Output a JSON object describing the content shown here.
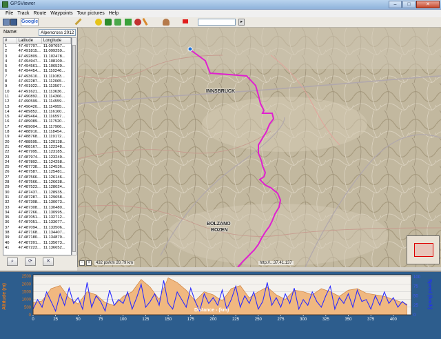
{
  "window": {
    "title": "GPSViewer",
    "minimize": "–",
    "maximize": "□",
    "close": "✕"
  },
  "menu": [
    "File",
    "Track",
    "Route",
    "Waypoints",
    "Tour pictures",
    "Help"
  ],
  "toolbar": {
    "google_label": "Google",
    "search_value": "",
    "search_go": "▸"
  },
  "panel": {
    "name_label": "Name:",
    "name_value": "Alpencross 2012",
    "columns": [
      "#",
      "Latitude",
      "Longitude"
    ],
    "rows": [
      [
        "1",
        "47.497707...",
        "11.097657..."
      ],
      [
        "2",
        "47.491815...",
        "11.099259..."
      ],
      [
        "3",
        "47.492809...",
        "11.102478..."
      ],
      [
        "4",
        "47.494947...",
        "11.108109..."
      ],
      [
        "5",
        "47.494561...",
        "11.106529..."
      ],
      [
        "6",
        "47.494454...",
        "11.110246..."
      ],
      [
        "7",
        "47.493610...",
        "11.111083..."
      ],
      [
        "8",
        "47.492287...",
        "11.112065..."
      ],
      [
        "9",
        "47.491922...",
        "11.113507..."
      ],
      [
        "10",
        "47.491621...",
        "11.113636..."
      ],
      [
        "11",
        "47.490892...",
        "11.114366..."
      ],
      [
        "12",
        "47.490599...",
        "11.114559..."
      ],
      [
        "13",
        "47.490420...",
        "11.114955..."
      ],
      [
        "14",
        "47.489852...",
        "11.116160..."
      ],
      [
        "15",
        "47.489464...",
        "11.116597..."
      ],
      [
        "16",
        "47.489089...",
        "11.117520..."
      ],
      [
        "17",
        "47.489004...",
        "11.117906..."
      ],
      [
        "18",
        "47.488910...",
        "11.118454..."
      ],
      [
        "19",
        "47.488768...",
        "11.119172..."
      ],
      [
        "20",
        "47.488595...",
        "11.120138..."
      ],
      [
        "21",
        "47.488167...",
        "11.122348..."
      ],
      [
        "22",
        "47.487995...",
        "11.123185..."
      ],
      [
        "23",
        "47.487974...",
        "11.123249..."
      ],
      [
        "24",
        "47.487802...",
        "11.124258..."
      ],
      [
        "25",
        "47.487738...",
        "11.124536..."
      ],
      [
        "26",
        "47.487587...",
        "11.125481..."
      ],
      [
        "27",
        "47.487566...",
        "11.126146..."
      ],
      [
        "28",
        "47.487566...",
        "11.126638..."
      ],
      [
        "29",
        "47.487523...",
        "11.128024..."
      ],
      [
        "30",
        "47.487437...",
        "11.128935..."
      ],
      [
        "31",
        "47.487287...",
        "11.129658..."
      ],
      [
        "32",
        "47.487308...",
        "11.130073..."
      ],
      [
        "33",
        "47.487308...",
        "11.130480..."
      ],
      [
        "34",
        "47.487266...",
        "11.130995..."
      ],
      [
        "35",
        "47.487051...",
        "11.132712..."
      ],
      [
        "36",
        "47.487051...",
        "11.133077..."
      ],
      [
        "37",
        "47.487094...",
        "11.133506..."
      ],
      [
        "38",
        "47.487168...",
        "11.134407..."
      ],
      [
        "39",
        "47.487180...",
        "11.134879..."
      ],
      [
        "40",
        "47.487201...",
        "11.135673..."
      ],
      [
        "41",
        "47.487223...",
        "11.136652..."
      ]
    ],
    "button_icons": [
      "magnifier-icon",
      "refresh-icon",
      "delete-icon"
    ]
  },
  "map": {
    "labels": [
      "INNSBRUCK",
      "BOLZANO",
      "BOZEN"
    ],
    "scale_text": "432 px/km 20.79 km",
    "coords_text": "http://...37.41.137",
    "zoom_out": "−",
    "zoom_in": "+",
    "route_color": "#e020d0"
  },
  "chart_data": {
    "type": "area",
    "xlabel": "Distance - (km)",
    "ylabel_left": "Altitude (m)",
    "ylabel_right": "Speed (km/h)",
    "x_ticks": [
      0,
      25,
      50,
      75,
      100,
      125,
      150,
      175,
      200,
      225,
      250,
      275,
      300,
      325,
      350,
      375,
      400
    ],
    "xlim": [
      0,
      420
    ],
    "y_left_ticks": [
      0,
      500,
      1000,
      1500,
      2000,
      2500
    ],
    "ylim_left": [
      0,
      2600
    ],
    "y_right_ticks": [
      0,
      25,
      50,
      75,
      100
    ],
    "ylim_right": [
      0,
      105
    ],
    "series": [
      {
        "name": "Altitude",
        "color": "#f0b880",
        "x": [
          0,
          10,
          20,
          30,
          40,
          50,
          60,
          70,
          80,
          90,
          100,
          110,
          120,
          130,
          140,
          150,
          160,
          170,
          180,
          190,
          200,
          210,
          220,
          230,
          240,
          250,
          260,
          270,
          280,
          290,
          300,
          310,
          320,
          330,
          340,
          350,
          360,
          370,
          380,
          390,
          400,
          410,
          415
        ],
        "values": [
          800,
          900,
          1700,
          1900,
          1100,
          700,
          1500,
          1300,
          800,
          600,
          1200,
          1500,
          2300,
          1800,
          1000,
          2400,
          2100,
          1600,
          900,
          1500,
          1300,
          900,
          1700,
          1900,
          1100,
          1500,
          1800,
          1300,
          1000,
          1600,
          1500,
          1300,
          1700,
          1500,
          1200,
          1600,
          1700,
          1400,
          1300,
          1200,
          1000,
          800,
          700
        ]
      },
      {
        "name": "Speed",
        "color": "#2b2bff",
        "x": [
          0,
          5,
          10,
          15,
          20,
          25,
          30,
          35,
          40,
          45,
          50,
          55,
          60,
          65,
          70,
          75,
          80,
          85,
          90,
          95,
          100,
          105,
          110,
          115,
          120,
          125,
          130,
          135,
          140,
          145,
          150,
          155,
          160,
          165,
          170,
          175,
          180,
          185,
          190,
          195,
          200,
          205,
          210,
          215,
          220,
          225,
          230,
          235,
          240,
          245,
          250,
          255,
          260,
          265,
          270,
          275,
          280,
          285,
          290,
          295,
          300,
          305,
          310,
          315,
          320,
          325,
          330,
          335,
          340,
          345,
          350,
          355,
          360,
          365,
          370,
          375,
          380,
          385,
          390,
          395,
          400,
          405,
          410,
          415
        ],
        "values": [
          15,
          40,
          20,
          60,
          35,
          10,
          55,
          25,
          70,
          30,
          45,
          15,
          85,
          20,
          50,
          35,
          10,
          65,
          25,
          40,
          30,
          60,
          15,
          45,
          80,
          20,
          35,
          55,
          25,
          90,
          30,
          15,
          60,
          40,
          20,
          70,
          35,
          10,
          55,
          30,
          45,
          25,
          65,
          15,
          40,
          75,
          20,
          50,
          30,
          60,
          15,
          35,
          85,
          25,
          45,
          20,
          55,
          30,
          70,
          15,
          40,
          25,
          60,
          35,
          20,
          50,
          75,
          15,
          45,
          30,
          55,
          20,
          65,
          35,
          40,
          15,
          50,
          25,
          60,
          30,
          45,
          20,
          35,
          25
        ]
      }
    ]
  }
}
